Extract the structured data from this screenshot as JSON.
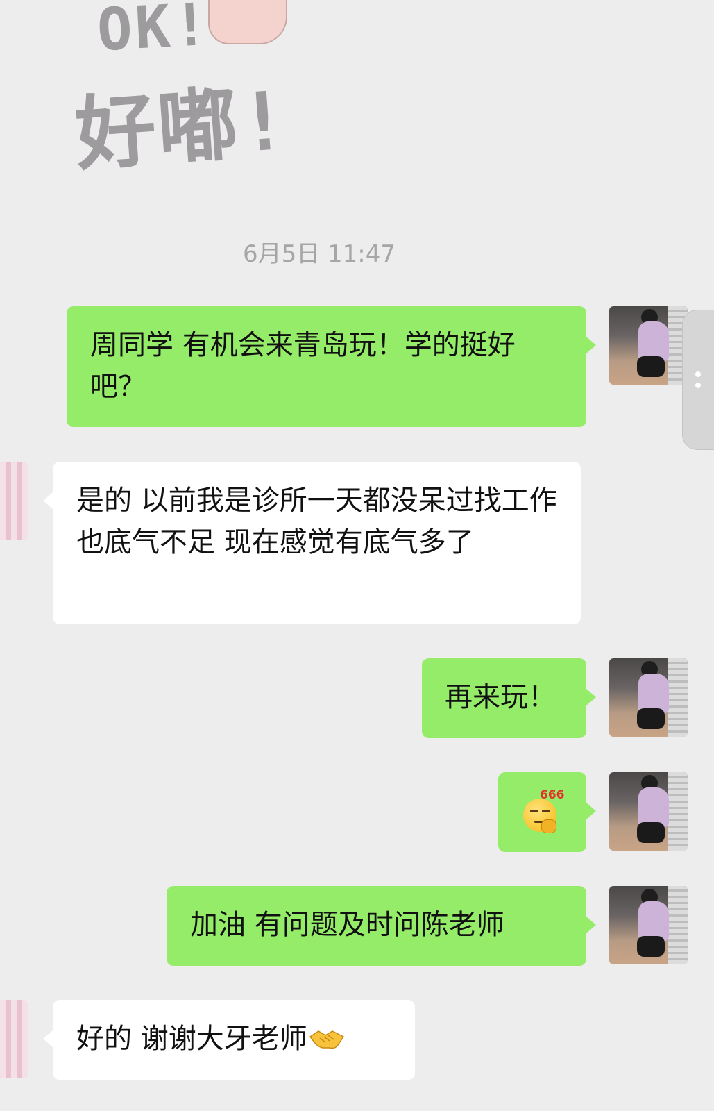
{
  "sticker": {
    "line1": "OK!",
    "line2": "好嘟!"
  },
  "timestamp": "6月5日 11:47",
  "messages": [
    {
      "sender": "self",
      "text": "周同学 有机会来青岛玩！学的挺好吧？"
    },
    {
      "sender": "other",
      "text": "是的 以前我是诊所一天都没呆过找工作也底气不足 现在感觉有底气多了"
    },
    {
      "sender": "self",
      "text": "再来玩！"
    },
    {
      "sender": "self",
      "type": "emoji",
      "emoji": "666"
    },
    {
      "sender": "self",
      "text": "加油 有问题及时问陈老师"
    },
    {
      "sender": "other",
      "text": "好的 谢谢大牙老师",
      "trailing_icon": "handshake-icon"
    }
  ],
  "colors": {
    "background": "#ededed",
    "outgoing_bubble": "#95ec69",
    "incoming_bubble": "#ffffff",
    "timestamp_text": "#a6a6a6"
  }
}
